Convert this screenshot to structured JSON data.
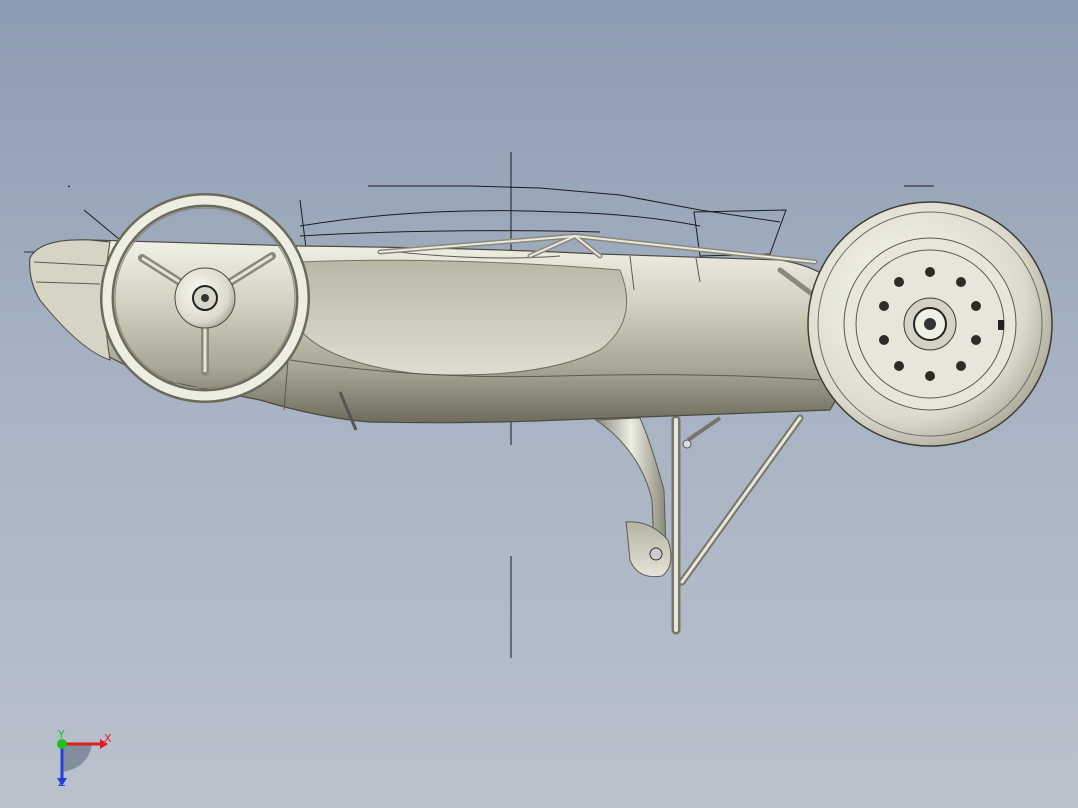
{
  "window": {
    "title": ""
  },
  "viewport": {
    "background_top": "#8b9bb1",
    "background_bottom": "#b9c1cc",
    "model_color": "#c8c6b6",
    "model_shadow": "#7c7a6a"
  },
  "triad": {
    "x_label": "X",
    "y_label": "Y",
    "z_label": "Z",
    "x_color": "#e02020",
    "y_color": "#20c020",
    "z_color": "#2040e0"
  }
}
